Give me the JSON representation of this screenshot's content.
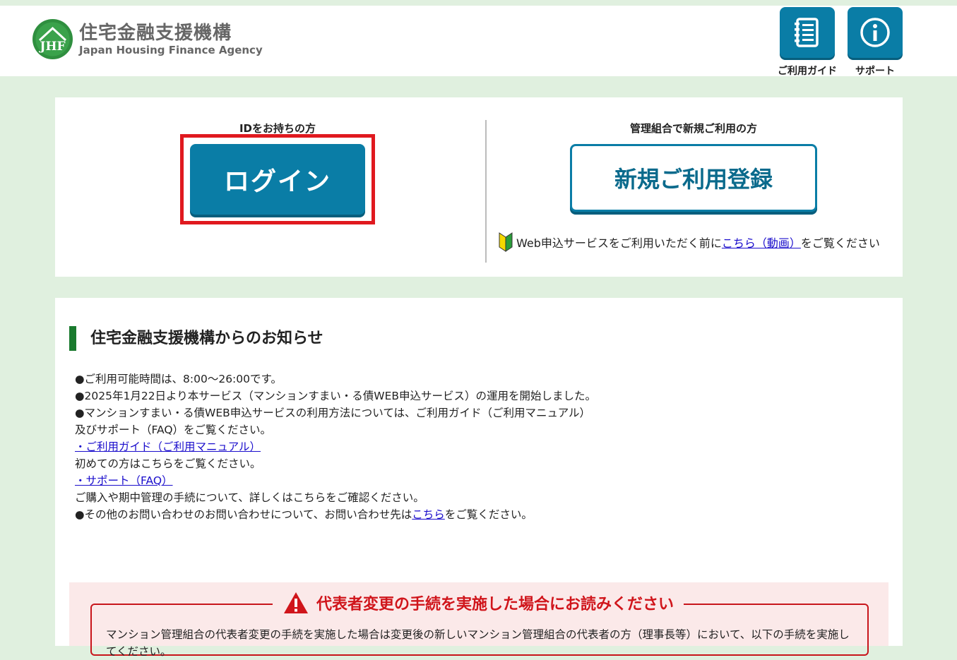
{
  "header": {
    "logo_mark": "JHF",
    "logo_jp": "住宅金融支援機構",
    "logo_en": "Japan Housing Finance Agency",
    "guide_label": "ご利用ガイド",
    "support_label": "サポート",
    "guide_icon": "notebook-icon",
    "support_icon": "info-icon"
  },
  "login_section": {
    "heading": "IDをお持ちの方",
    "button_label": "ログイン"
  },
  "register_section": {
    "heading": "管理組合で新規ご利用の方",
    "button_label": "新規ご利用登録",
    "note_prefix": "Web申込サービスをご利用いただく前に",
    "note_link": "こちら（動画）",
    "note_suffix": "をご覧ください",
    "note_icon": "beginner-mark-icon"
  },
  "news": {
    "title": "住宅金融支援機構からのお知らせ",
    "line1": "●ご利用可能時間は、8:00～26:00です。",
    "line2": "●2025年1月22日より本サービス（マンションすまい・る債WEB申込サービス）の運用を開始しました。",
    "line3": "●マンションすまい・る債WEB申込サービスの利用方法については、ご利用ガイド（ご利用マニュアル）",
    "line4": "及びサポート（FAQ）をご覧ください。",
    "guide_link": "・ご利用ガイド（ご利用マニュアル）",
    "line5": "初めての方はこちらをご覧ください。",
    "faq_link": "・サポート（FAQ）",
    "line6": "ご購入や期中管理の手続について、詳しくはこちらをご確認ください。",
    "line7_prefix": "●その他のお問い合わせのお問い合わせについて、お問い合わせ先は",
    "line7_link": "こちら",
    "line7_suffix": "をご覧ください。"
  },
  "notice": {
    "title": "代表者変更の手続を実施した場合にお読みください",
    "text": "マンション管理組合の代表者変更の手続を実施した場合は変更後の新しいマンション管理組合の代表者の方（理事長等）において、以下の手続を実施してください。",
    "icon": "warning-icon"
  },
  "colors": {
    "background": "#e0f0df",
    "primary": "#0a7da6",
    "highlight_border": "#e0191f",
    "news_bar": "#1a7a2e",
    "warning": "#d0151b"
  }
}
